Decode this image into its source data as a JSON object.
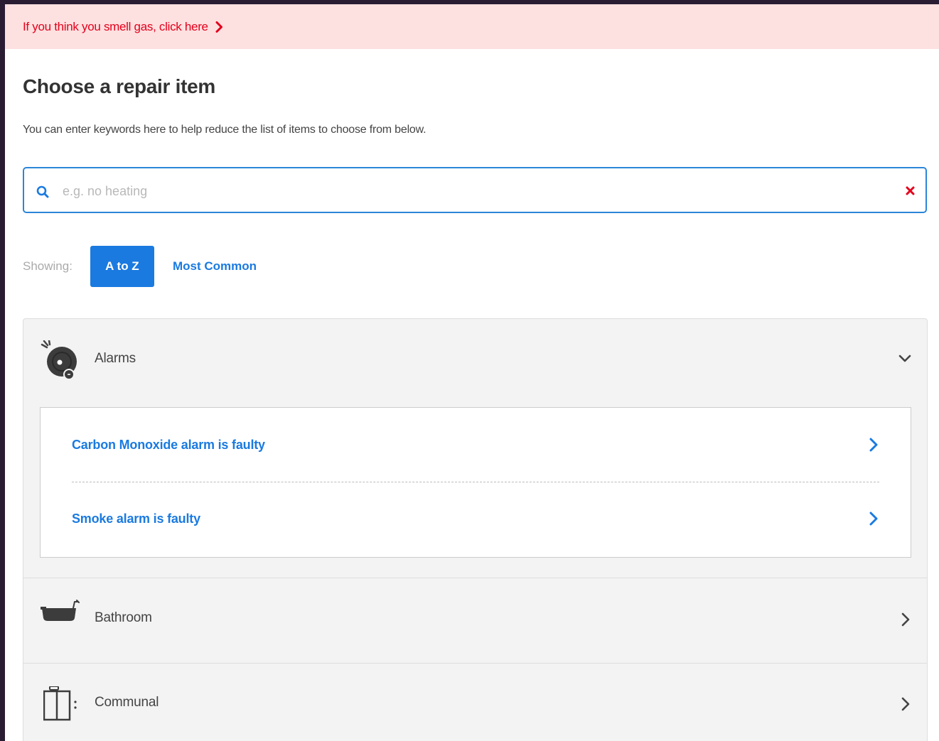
{
  "gas_banner": {
    "text": "If you think you smell gas, click here",
    "icon": "chevron-right-icon",
    "color": "#e4001b",
    "background": "#fde0e0"
  },
  "title": "Choose a repair item",
  "subtitle": "You can enter keywords here to help reduce the list of items to choose from below.",
  "search": {
    "placeholder": "e.g. no heating",
    "value": "",
    "search_icon": "search-icon",
    "clear_icon": "close-icon"
  },
  "showing": {
    "label": "Showing:",
    "tabs": [
      {
        "label": "A to Z",
        "active": true
      },
      {
        "label": "Most Common",
        "active": false
      }
    ]
  },
  "categories": [
    {
      "name": "Alarms",
      "icon": "alarm-icon",
      "expanded": true,
      "items": [
        {
          "label": "Carbon Monoxide alarm is faulty"
        },
        {
          "label": "Smoke alarm is faulty"
        }
      ]
    },
    {
      "name": "Bathroom",
      "icon": "bathtub-icon",
      "expanded": false,
      "items": []
    },
    {
      "name": "Communal",
      "icon": "lift-icon",
      "expanded": false,
      "items": []
    }
  ],
  "colors": {
    "accent": "#1a7ae0",
    "search_border": "#2b86d8",
    "alert": "#e4001b"
  }
}
